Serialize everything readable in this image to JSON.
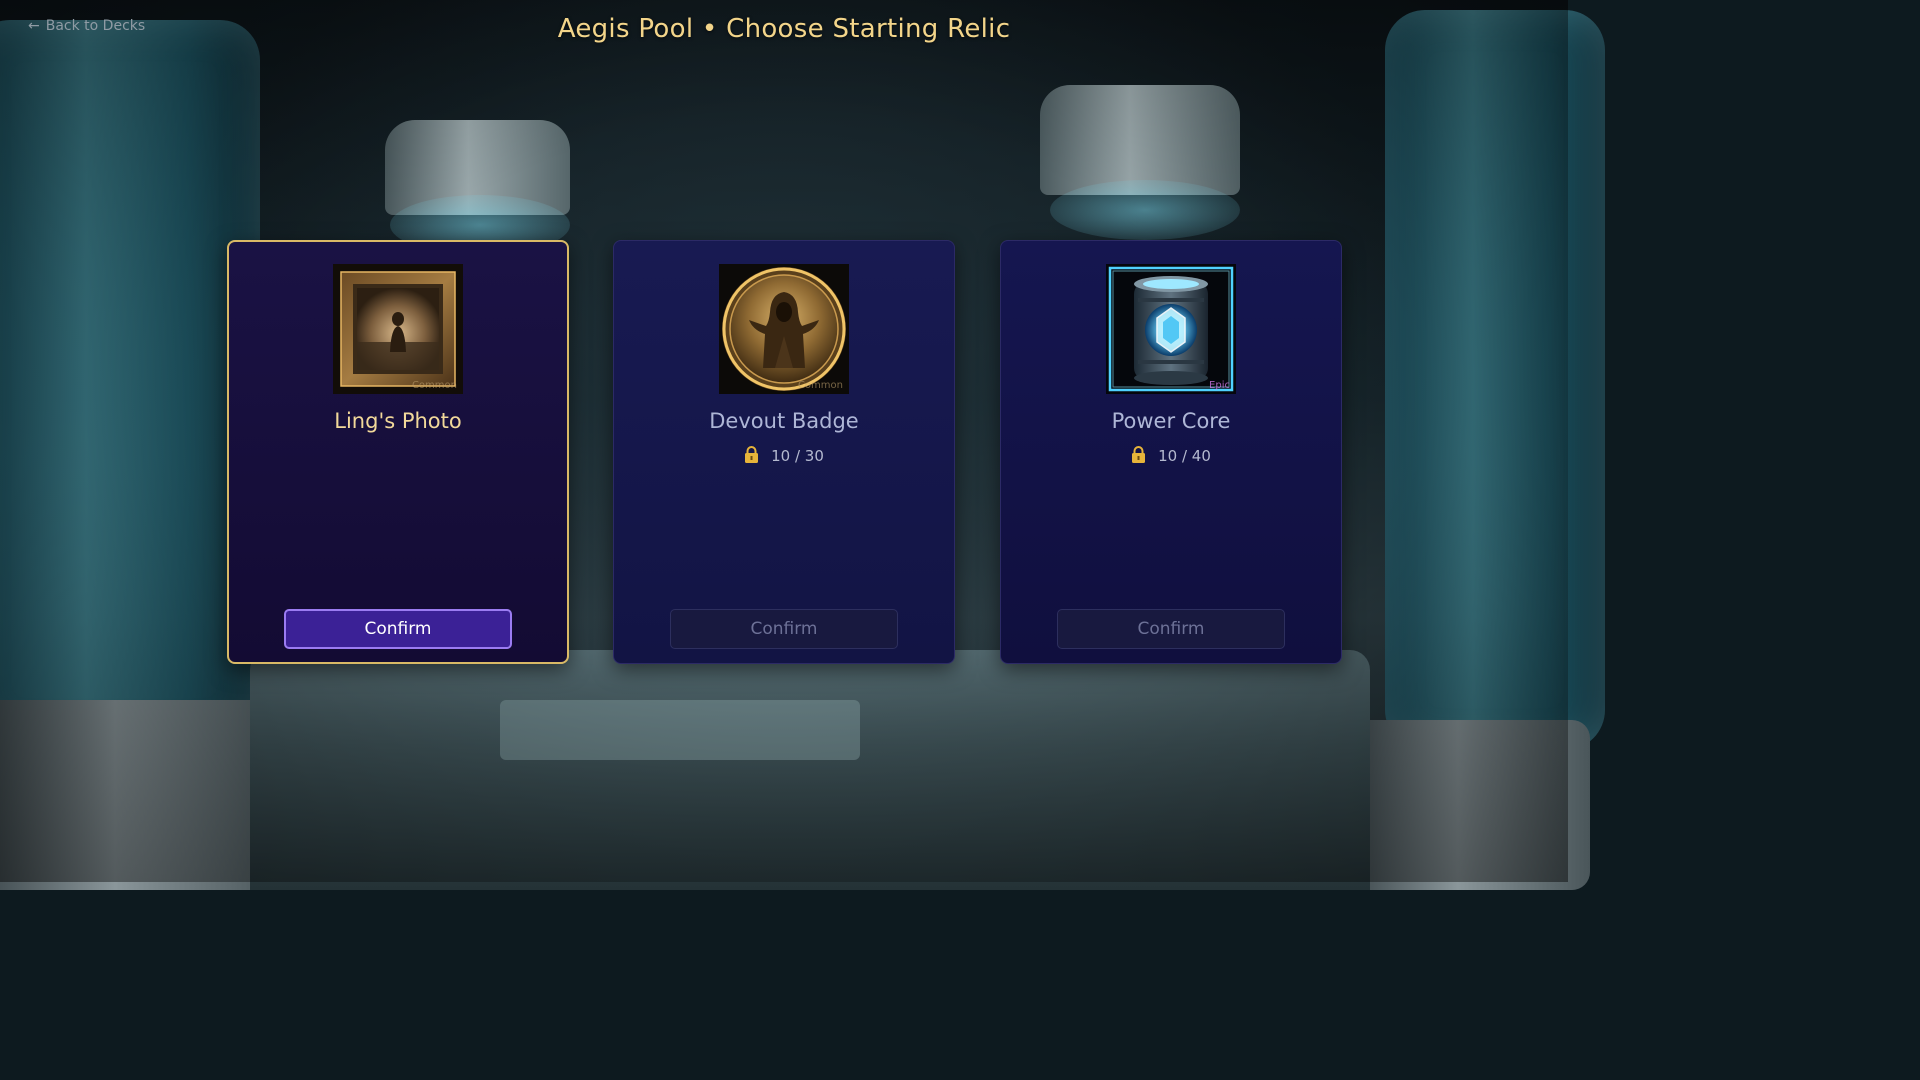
{
  "header": {
    "back_label": "Back to Decks",
    "back_arrow": "←",
    "title": "Aegis Pool • Choose Starting Relic"
  },
  "relics": [
    {
      "name": "Ling's Photo",
      "rarity": "Common",
      "icon": "framed-photo-icon",
      "selected": true,
      "locked": false,
      "progress": "",
      "confirm_label": "Confirm"
    },
    {
      "name": "Devout Badge",
      "rarity": "Common",
      "icon": "hooded-figure-badge-icon",
      "selected": false,
      "locked": true,
      "progress": "10 / 30",
      "confirm_label": "Confirm"
    },
    {
      "name": "Power Core",
      "rarity": "Epic",
      "icon": "glowing-crystal-core-icon",
      "selected": false,
      "locked": true,
      "progress": "10 / 40",
      "confirm_label": "Confirm"
    }
  ],
  "colors": {
    "title": "#f3d58a",
    "selected_border": "#d9b966",
    "confirm_active": "#3b2196",
    "lock": "#e7b43a"
  }
}
